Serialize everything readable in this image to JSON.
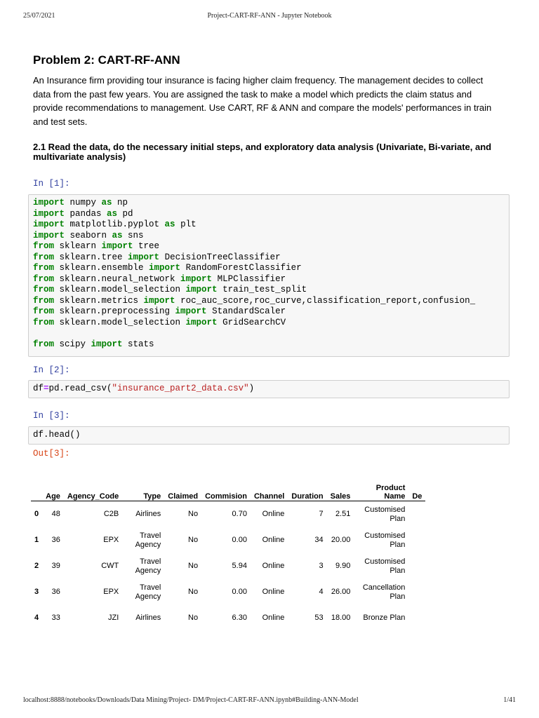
{
  "header": {
    "date": "25/07/2021",
    "title": "Project-CART-RF-ANN - Jupyter Notebook"
  },
  "footer": {
    "url": "localhost:8888/notebooks/Downloads/Data Mining/Project- DM/Project-CART-RF-ANN.ipynb#Building-ANN-Model",
    "page": "1/41"
  },
  "title": "Problem 2: CART-RF-ANN",
  "intro": "An Insurance firm providing tour insurance is facing higher claim frequency. The management decides to collect data from the past few years. You are assigned the task to make a model which predicts the claim status and provide recommendations to management. Use CART, RF & ANN and compare the models' performances in train and test sets.",
  "section": "2.1 Read the data, do the necessary initial steps, and exploratory data analysis (Univariate, Bi-variate, and multivariate analysis)",
  "cells": [
    {
      "prompt": "In [1]:",
      "lines": [
        [
          [
            "kw",
            "import"
          ],
          [
            "p",
            " numpy "
          ],
          [
            "kw",
            "as"
          ],
          [
            "p",
            " np"
          ]
        ],
        [
          [
            "kw",
            "import"
          ],
          [
            "p",
            " pandas "
          ],
          [
            "kw",
            "as"
          ],
          [
            "p",
            " pd"
          ]
        ],
        [
          [
            "kw",
            "import"
          ],
          [
            "p",
            " matplotlib.pyplot "
          ],
          [
            "kw",
            "as"
          ],
          [
            "p",
            " plt"
          ]
        ],
        [
          [
            "kw",
            "import"
          ],
          [
            "p",
            " seaborn "
          ],
          [
            "kw",
            "as"
          ],
          [
            "p",
            " sns"
          ]
        ],
        [
          [
            "kw",
            "from"
          ],
          [
            "p",
            " sklearn "
          ],
          [
            "kw",
            "import"
          ],
          [
            "p",
            " tree"
          ]
        ],
        [
          [
            "kw",
            "from"
          ],
          [
            "p",
            " sklearn.tree "
          ],
          [
            "kw",
            "import"
          ],
          [
            "p",
            " DecisionTreeClassifier"
          ]
        ],
        [
          [
            "kw",
            "from"
          ],
          [
            "p",
            " sklearn.ensemble "
          ],
          [
            "kw",
            "import"
          ],
          [
            "p",
            " RandomForestClassifier"
          ]
        ],
        [
          [
            "kw",
            "from"
          ],
          [
            "p",
            " sklearn.neural_network "
          ],
          [
            "kw",
            "import"
          ],
          [
            "p",
            " MLPClassifier"
          ]
        ],
        [
          [
            "kw",
            "from"
          ],
          [
            "p",
            " sklearn.model_selection "
          ],
          [
            "kw",
            "import"
          ],
          [
            "p",
            " train_test_split"
          ]
        ],
        [
          [
            "kw",
            "from"
          ],
          [
            "p",
            " sklearn.metrics "
          ],
          [
            "kw",
            "import"
          ],
          [
            "p",
            " roc_auc_score,roc_curve,classification_report,confusion_"
          ]
        ],
        [
          [
            "kw",
            "from"
          ],
          [
            "p",
            " sklearn.preprocessing "
          ],
          [
            "kw",
            "import"
          ],
          [
            "p",
            " StandardScaler"
          ]
        ],
        [
          [
            "kw",
            "from"
          ],
          [
            "p",
            " sklearn.model_selection "
          ],
          [
            "kw",
            "import"
          ],
          [
            "p",
            " GridSearchCV"
          ]
        ],
        [
          [
            "p",
            " "
          ]
        ],
        [
          [
            "kw",
            "from"
          ],
          [
            "p",
            " scipy "
          ],
          [
            "kw",
            "import"
          ],
          [
            "p",
            " stats"
          ]
        ]
      ]
    },
    {
      "prompt": "In [2]:",
      "lines": [
        [
          [
            "p",
            "df"
          ],
          [
            "op",
            "="
          ],
          [
            "p",
            "pd.read_csv("
          ],
          [
            "str",
            "\"insurance_part2_data.csv\""
          ],
          [
            "p",
            ")"
          ]
        ]
      ]
    },
    {
      "prompt": "In [3]:",
      "lines": [
        [
          [
            "p",
            "df.head()"
          ]
        ]
      ]
    }
  ],
  "out_prompt": "Out[3]:",
  "table": {
    "columns": [
      "",
      "Age",
      "Agency_Code",
      "Type",
      "Claimed",
      "Commision",
      "Channel",
      "Duration",
      "Sales",
      "Product Name",
      "De"
    ],
    "rows": [
      [
        "0",
        "48",
        "C2B",
        "Airlines",
        "No",
        "0.70",
        "Online",
        "7",
        "2.51",
        "Customised Plan",
        ""
      ],
      [
        "1",
        "36",
        "EPX",
        "Travel Agency",
        "No",
        "0.00",
        "Online",
        "34",
        "20.00",
        "Customised Plan",
        ""
      ],
      [
        "2",
        "39",
        "CWT",
        "Travel Agency",
        "No",
        "5.94",
        "Online",
        "3",
        "9.90",
        "Customised Plan",
        ""
      ],
      [
        "3",
        "36",
        "EPX",
        "Travel Agency",
        "No",
        "0.00",
        "Online",
        "4",
        "26.00",
        "Cancellation Plan",
        ""
      ],
      [
        "4",
        "33",
        "JZI",
        "Airlines",
        "No",
        "6.30",
        "Online",
        "53",
        "18.00",
        "Bronze Plan",
        ""
      ]
    ]
  }
}
